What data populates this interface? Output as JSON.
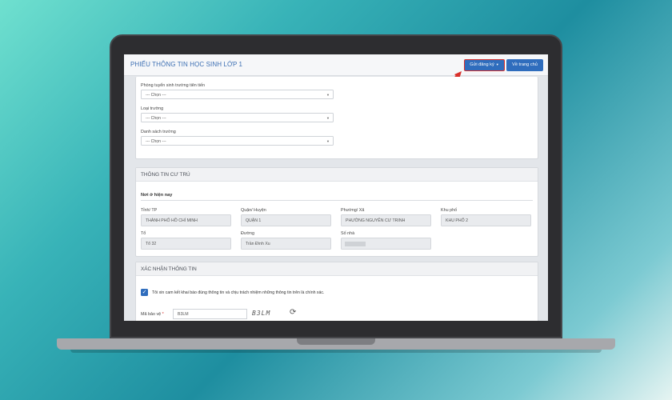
{
  "header": {
    "title": "PHIẾU THÔNG TIN HỌC SINH LỚP 1",
    "submit_label": "Gửi đăng ký",
    "home_label": "Về trang chủ"
  },
  "selection": {
    "fields": [
      {
        "label": "Phòng tuyển sinh trường tiên tiến",
        "value": "--- Chọn ---"
      },
      {
        "label": "Loại trường",
        "value": "--- Chọn ---"
      },
      {
        "label": "Danh sách trường",
        "value": "--- Chọn ---"
      }
    ]
  },
  "residence": {
    "title": "THÔNG TIN CƯ TRÚ",
    "subtitle": "Nơi ở hiện nay",
    "fields": [
      {
        "label": "Tỉnh/ TP",
        "value": "THÀNH PHỐ HỒ CHÍ MINH"
      },
      {
        "label": "Quận/ Huyện",
        "value": "QUẬN 1"
      },
      {
        "label": "Phường/ Xã",
        "value": "PHƯỜNG NGUYỄN CƯ TRINH"
      },
      {
        "label": "Khu phố",
        "value": "KHU PHỐ 2"
      },
      {
        "label": "Tổ",
        "value": "Tổ 32"
      },
      {
        "label": "Đường",
        "value": "Trần Đình Xu"
      },
      {
        "label": "Số nhà",
        "value": ""
      }
    ]
  },
  "confirm": {
    "title": "XÁC NHẬN THÔNG TIN",
    "checkbox_text": "Tôi xin cam kết khai báo đúng thông tin và chịu trách nhiệm những thông tin trên là chính xác.",
    "checked": true,
    "captcha_label": "Mã bảo vệ",
    "captcha_required": "*",
    "captcha_value": "B3LM",
    "captcha_image_text": "B3LM"
  },
  "colors": {
    "primary": "#2f6dbd",
    "highlight": "#d9302b",
    "title_blue": "#3c6fb3"
  },
  "icons": {
    "dropdown": "caret-down-icon",
    "refresh": "refresh-icon",
    "check": "check-icon"
  }
}
